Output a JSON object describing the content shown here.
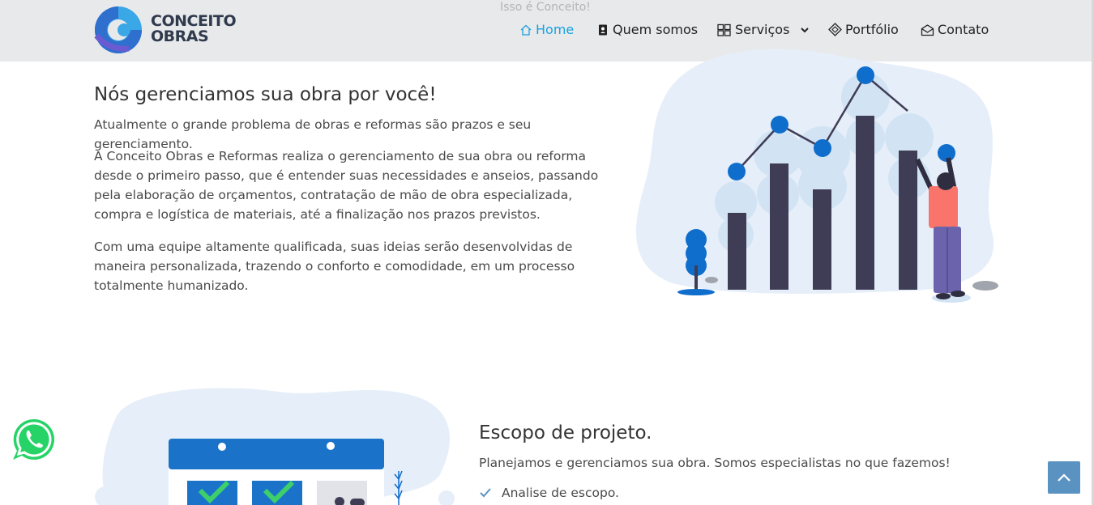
{
  "header": {
    "tagline": "Isso é Conceito!",
    "logo": {
      "line1": "CONCEITO",
      "line2": "OBRAS"
    },
    "nav": [
      {
        "label": "Home",
        "icon": "home-icon",
        "active": true
      },
      {
        "label": "Quem somos",
        "icon": "contact-card-icon",
        "active": false
      },
      {
        "label": "Serviços",
        "icon": "grid-icon",
        "active": false
      },
      {
        "label": "Portfólio",
        "icon": "diamond-icon",
        "active": false
      },
      {
        "label": "Contato",
        "icon": "envelope-icon",
        "active": false
      }
    ]
  },
  "intro": {
    "title": "Nós gerenciamos sua obra por você!",
    "paragraphs": [
      "Atualmente o grande problema de obras e reformas são prazos e seu gerenciamento.",
      "A Conceito Obras e Reformas realiza o gerenciamento de sua obra ou reforma desde o primeiro passo, que é entender suas necessidades e anseios, passando pela elaboração de orçamentos, contratação de mão de obra especializada, compra e logística de materiais, até a finalização nos prazos previstos.",
      "Com uma equipe altamente qualificada, suas ideias serão desenvolvidas de maneira personalizada, trazendo o conforto e comodidade, em um processo totalmente humanizado."
    ]
  },
  "scope": {
    "title": "Escopo de projeto.",
    "text": "Planejamos e gerenciamos sua obra. Somos especialistas no que fazemos!",
    "items": [
      "Analise de escopo."
    ]
  },
  "colors": {
    "accent": "#1aa1e0",
    "illustration_blue": "#0f6dcc",
    "bars": "#3f3d56",
    "back_to_top": "#5a93c2",
    "whatsapp": "#25d366"
  }
}
